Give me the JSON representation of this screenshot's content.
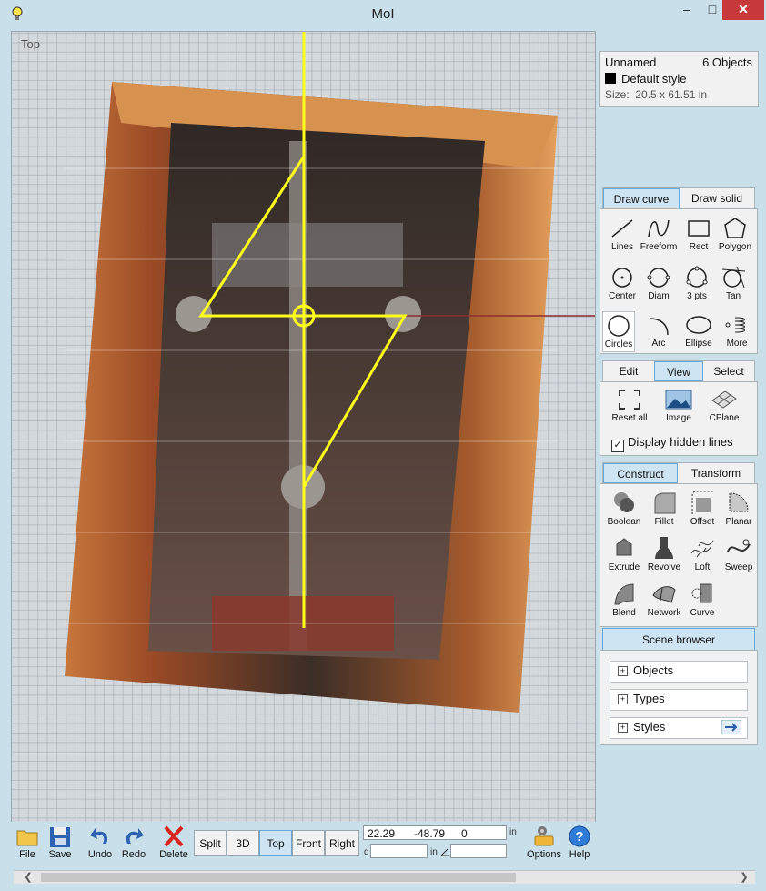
{
  "window": {
    "title": "MoI",
    "close_symbol": "✕",
    "minimize_symbol": "–",
    "maximize_symbol": "□"
  },
  "viewport": {
    "label": "Top"
  },
  "document": {
    "name": "Unnamed",
    "object_count": "6 Objects",
    "style_name": "Default style",
    "size_label": "Size:",
    "size_value": "20.5 x 61.51 in"
  },
  "draw_tabs": {
    "curve": "Draw curve",
    "solid": "Draw solid"
  },
  "draw_curve_tools": {
    "lines": "Lines",
    "freeform": "Freeform",
    "rect": "Rect",
    "polygon": "Polygon",
    "center": "Center",
    "diam": "Diam",
    "three_pts": "3 pts",
    "tan": "Tan",
    "circles": "Circles",
    "arc": "Arc",
    "ellipse": "Ellipse",
    "more": "More"
  },
  "view_tabs": {
    "edit": "Edit",
    "view": "View",
    "select": "Select"
  },
  "view_tools": {
    "reset_all": "Reset all",
    "image": "Image",
    "cplane": "CPlane"
  },
  "display_hidden_lines": {
    "label": "Display hidden lines",
    "checked": true
  },
  "construct_tabs": {
    "construct": "Construct",
    "transform": "Transform"
  },
  "construct_tools": {
    "boolean": "Boolean",
    "fillet": "Fillet",
    "offset": "Offset",
    "planar": "Planar",
    "extrude": "Extrude",
    "revolve": "Revolve",
    "loft": "Loft",
    "sweep": "Sweep",
    "blend": "Blend",
    "network": "Network",
    "curve": "Curve"
  },
  "scene_browser": {
    "title": "Scene browser",
    "items": [
      "Objects",
      "Types",
      "Styles"
    ]
  },
  "bottom_toolbar": {
    "file": "File",
    "save": "Save",
    "undo": "Undo",
    "redo": "Redo",
    "delete": "Delete",
    "options": "Options",
    "help": "Help"
  },
  "view_modes": {
    "split": "Split",
    "three_d": "3D",
    "top": "Top",
    "front": "Front",
    "right": "Right",
    "active": "Top"
  },
  "coordinates": {
    "x": "22.29",
    "y": "-48.79",
    "z": "0",
    "unit": "in",
    "distance_label": "d",
    "distance_value": "",
    "angle_unit": "in",
    "angle_value": ""
  },
  "colors": {
    "window_background": "#c9dfe9",
    "active_tab": "#cfe4f3",
    "construction_line": "#ffff1a",
    "axis_x": "#8b2f2f",
    "close_button": "#c7383a"
  }
}
